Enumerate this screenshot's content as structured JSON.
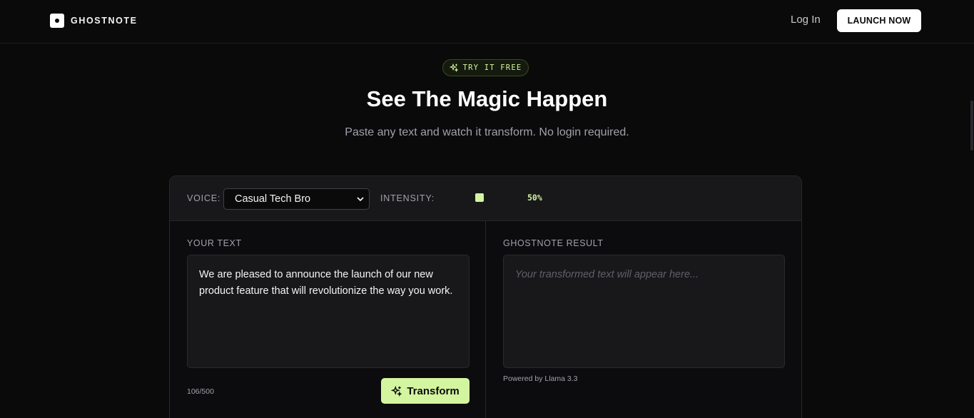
{
  "nav": {
    "brand": "GHOSTNOTE",
    "login_label": "Log In",
    "launch_label": "LAUNCH NOW"
  },
  "hero": {
    "badge": "TRY IT FREE",
    "badge_icon": "sparkles-icon",
    "title": "See The Magic Happen",
    "subtitle": "Paste any text and watch it transform. No login required."
  },
  "controls": {
    "voice_label": "VOICE:",
    "voice_value": "Casual Tech Bro",
    "intensity_label": "INTENSITY:",
    "intensity_value": "50%",
    "intensity_fraction": 0.5
  },
  "input": {
    "label": "YOUR TEXT",
    "text": "We are pleased to announce the launch of our new product feature that will revolutionize the way you work.",
    "counter": "106/500",
    "button_label": "Transform",
    "button_icon": "sparkles-icon"
  },
  "output": {
    "label": "GHOSTNOTE RESULT",
    "placeholder": "Your transformed text will appear here...",
    "powered_by": "Powered by Llama 3.3"
  },
  "colors": {
    "background": "#0a0a0b",
    "accent": "#d4f5a0",
    "panel": "#18181b"
  }
}
